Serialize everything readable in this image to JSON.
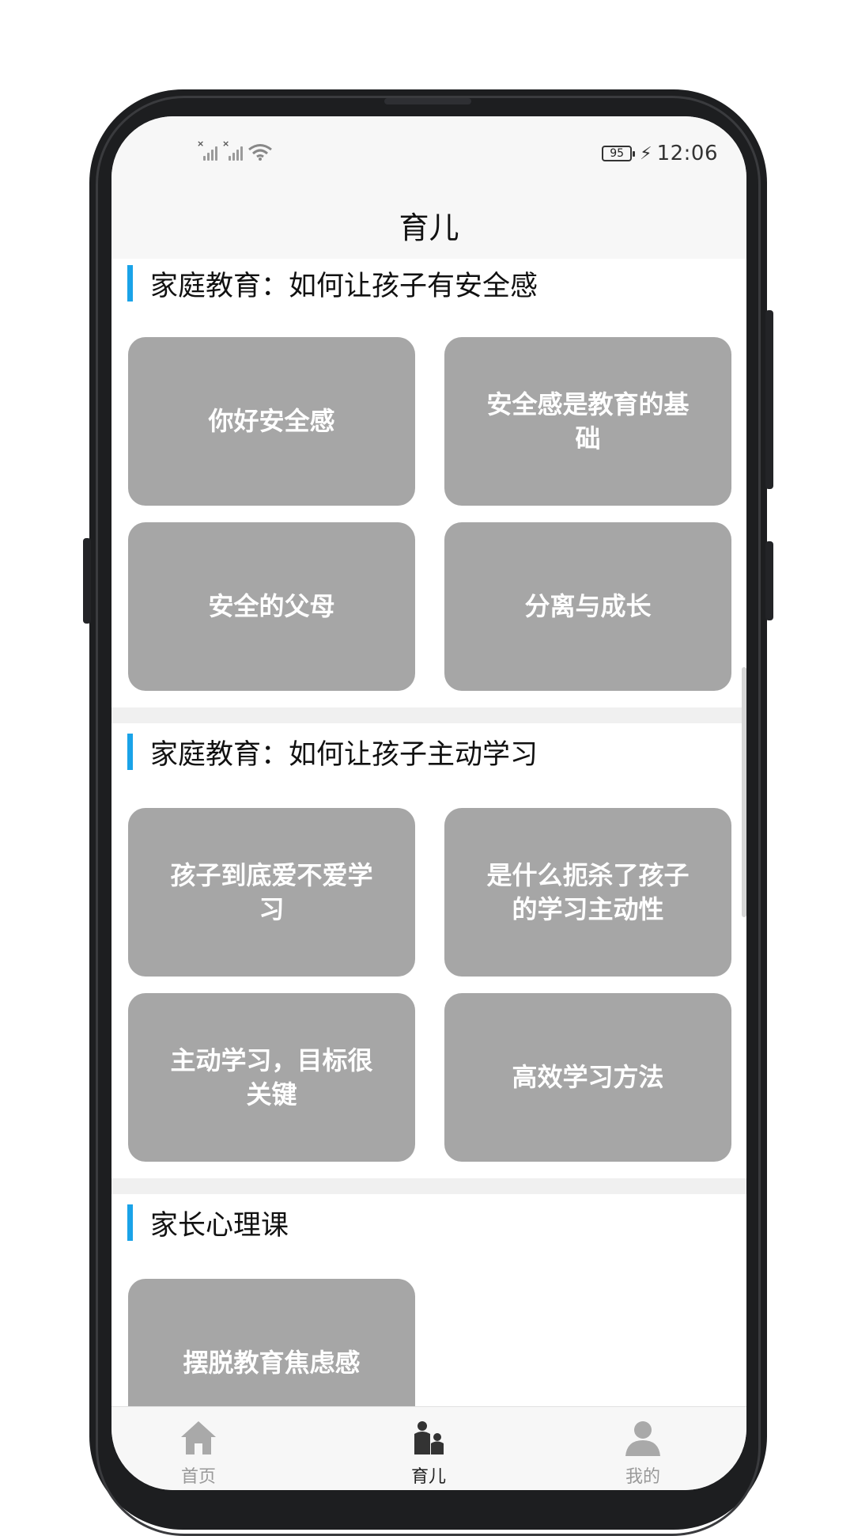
{
  "status_bar": {
    "battery": "95",
    "time": "12:06"
  },
  "header": {
    "title": "育儿"
  },
  "sections": [
    {
      "title": "家庭教育：如何让孩子有安全感",
      "cards": [
        "你好安全感",
        "安全感是教育的基础",
        "安全的父母",
        "分离与成长"
      ]
    },
    {
      "title": "家庭教育：如何让孩子主动学习",
      "cards": [
        "孩子到底爱不爱学习",
        "是什么扼杀了孩子的学习主动性",
        "主动学习，目标很关键",
        "高效学习方法"
      ]
    },
    {
      "title": "家长心理课",
      "cards": [
        "摆脱教育焦虑感"
      ]
    }
  ],
  "tabbar": {
    "items": [
      {
        "label": "首页",
        "icon": "home-icon"
      },
      {
        "label": "育儿",
        "icon": "parenting-icon"
      },
      {
        "label": "我的",
        "icon": "profile-icon"
      }
    ],
    "active": "育儿"
  },
  "colors": {
    "accent": "#1aa3e8",
    "card": "#a6a6a6",
    "background": "#f0f0f0"
  }
}
